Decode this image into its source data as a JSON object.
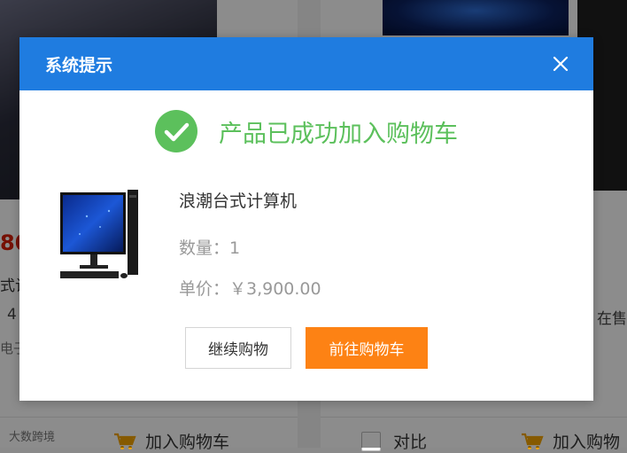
{
  "background": {
    "price_fragment": "80",
    "title_fragment": "式计",
    "number_fragment": "4",
    "vendor_fragment": "电子",
    "onsale_text": "在售",
    "watermark_text": "大数跨境",
    "add_to_cart_label": "加入购物车",
    "add_to_cart_label_b": "加入购物",
    "compare_label": "对比"
  },
  "modal": {
    "title": "系统提示",
    "success_message": "产品已成功加入购物车",
    "product": {
      "name": "浪潮台式计算机",
      "quantity_text": "数量：1",
      "price_text": "单价：￥3,900.00"
    },
    "buttons": {
      "continue_label": "继续购物",
      "go_to_cart_label": "前往购物车"
    }
  },
  "colors": {
    "header_blue": "#1f7ce0",
    "success_green": "#5cc05c",
    "cart_orange": "#fd8214",
    "price_red": "#d81e06"
  },
  "icons": {
    "close": "close-icon",
    "success": "check-circle-icon",
    "cart": "shopping-cart-icon"
  }
}
